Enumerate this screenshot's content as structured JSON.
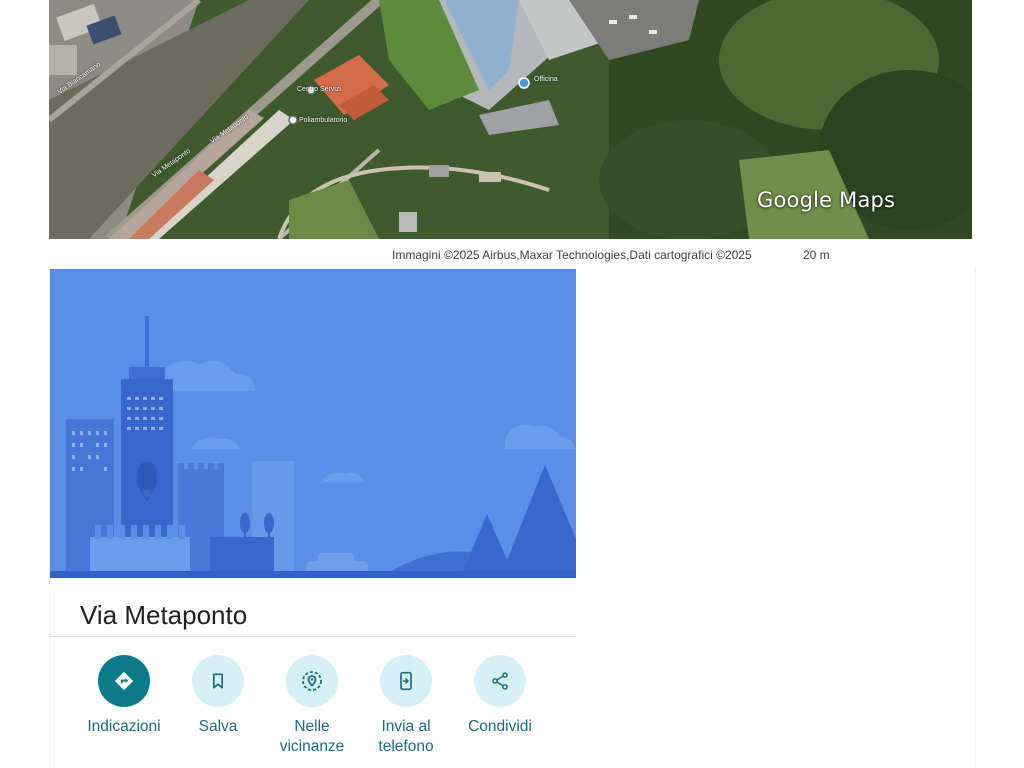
{
  "map": {
    "logo": "Google Maps",
    "labels": {
      "street_diagonal": "Via Metaponto",
      "street_lower": "Via Metaponto",
      "poi_1": "Centro Servizi",
      "poi_2": "Poliambulatorio",
      "poi_3": "Officina",
      "street_left": "Via Biancamano"
    },
    "attribution": "Immagini ©2025 Airbus,Maxar Technologies,Dati cartografici ©2025",
    "scale": "20 m"
  },
  "place": {
    "title": "Via Metaponto"
  },
  "actions": [
    {
      "label_line1": "Indicazioni",
      "label_line2": "",
      "icon": "directions-icon"
    },
    {
      "label_line1": "Salva",
      "label_line2": "",
      "icon": "bookmark-icon"
    },
    {
      "label_line1": "Nelle",
      "label_line2": "vicinanze",
      "icon": "nearby-icon"
    },
    {
      "label_line1": "Invia al",
      "label_line2": "telefono",
      "icon": "send-to-phone-icon"
    },
    {
      "label_line1": "Condividi",
      "label_line2": "",
      "icon": "share-icon"
    }
  ],
  "colors": {
    "primary_action": "#0b7b8c",
    "action_bg": "#d6f1f6",
    "action_text": "#1b6d7a",
    "hero_bg": "#5b8ee6"
  }
}
